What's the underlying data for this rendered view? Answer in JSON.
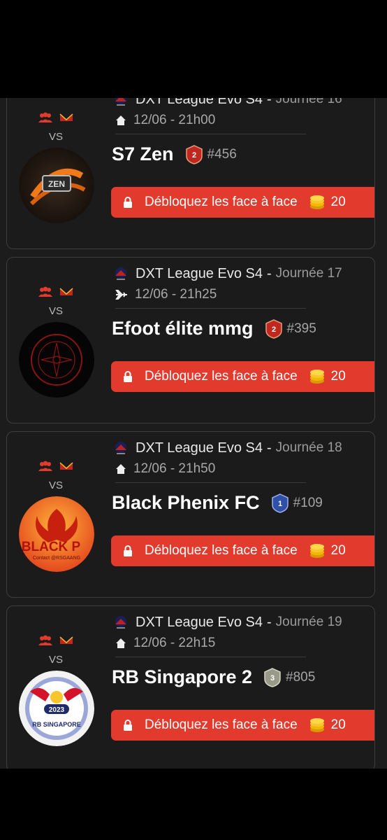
{
  "matches": [
    {
      "competition": "DXT League Evo S4",
      "round": "Journée 16",
      "venue_icon": "home-icon",
      "datetime": "12/06 - 21h00",
      "team": "S7 Zen",
      "badge_level": "2",
      "badge_color": "#c0281f",
      "rank": "#456",
      "vs": "VS",
      "unlock_label": "Débloquez les face à face",
      "cost": "20",
      "logo": "s7-zen"
    },
    {
      "competition": "DXT League Evo S4",
      "round": "Journée 17",
      "venue_icon": "plane-icon",
      "datetime": "12/06 - 21h25",
      "team": "Efoot élite mmg",
      "badge_level": "2",
      "badge_color": "#c0281f",
      "rank": "#395",
      "vs": "VS",
      "unlock_label": "Débloquez les face à face",
      "cost": "20",
      "logo": "efoot-elite"
    },
    {
      "competition": "DXT League Evo S4",
      "round": "Journée 18",
      "venue_icon": "home-icon",
      "datetime": "12/06 - 21h50",
      "team": "Black Phenix FC",
      "badge_level": "1",
      "badge_color": "#2f4fa8",
      "rank": "#109",
      "vs": "VS",
      "unlock_label": "Débloquez les face à face",
      "cost": "20",
      "logo": "black-phenix",
      "logo_text": "BLACK P",
      "logo_subtext": "Contact @RSGAANG"
    },
    {
      "competition": "DXT League Evo S4",
      "round": "Journée 19",
      "venue_icon": "home-icon",
      "datetime": "12/06 - 22h15",
      "team": "RB Singapore 2",
      "badge_level": "3",
      "badge_color": "#9a9a8a",
      "rank": "#805",
      "vs": "VS",
      "unlock_label": "Débloquez les face à face",
      "cost": "20",
      "logo": "rb-singapore",
      "logo_text": "2023",
      "logo_subtext": "RB SINGAPORE"
    }
  ],
  "colors": {
    "accent": "#e23b2e",
    "card_bg": "#1b1b1b",
    "card_border": "#3e3e3e",
    "coin": "#f2b705"
  }
}
